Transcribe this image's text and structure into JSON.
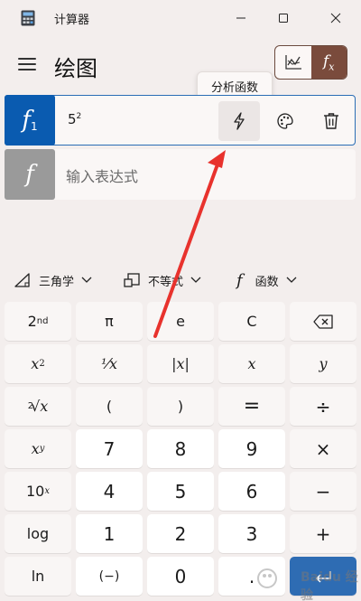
{
  "window": {
    "app_title": "计算器"
  },
  "header": {
    "page_title": "绘图"
  },
  "tooltip": {
    "text": "分析函数"
  },
  "functions": [
    {
      "badge": "f",
      "index": "1",
      "base": "5",
      "exponent": "2"
    },
    {
      "badge": "f",
      "placeholder": "输入表达式"
    }
  ],
  "toolbar": {
    "trig_label": "三角学",
    "inequality_label": "不等式",
    "function_label": "函数"
  },
  "keys": {
    "row1": [
      "2nd",
      "π",
      "e",
      "C",
      "backspace"
    ],
    "row2": [
      "x²",
      "⅟x",
      "|x|",
      "x",
      "y"
    ],
    "row3": [
      "²√x",
      "(",
      ")",
      "=",
      "÷"
    ],
    "row4": [
      "xʸ",
      "7",
      "8",
      "9",
      "×"
    ],
    "row5": [
      "10ˣ",
      "4",
      "5",
      "6",
      "−"
    ],
    "row6": [
      "log",
      "1",
      "2",
      "3",
      "+"
    ],
    "row7": [
      "ln",
      "(−)",
      "0",
      ".",
      "enter"
    ]
  },
  "key_text": {
    "second": "2",
    "second_sup": "nd",
    "pi": "π",
    "e": "e",
    "clear": "C",
    "x_base": "x",
    "x_sq_sup": "2",
    "reciprocal": "⅟x",
    "abs": "|x|",
    "x": "x",
    "y": "y",
    "root_idx": "2",
    "root": "√x",
    "lparen": "(",
    "rparen": ")",
    "equals": "=",
    "divide": "÷",
    "xy_base": "x",
    "xy_sup": "y",
    "seven": "7",
    "eight": "8",
    "nine": "9",
    "times": "×",
    "ten": "10",
    "ten_sup": "x",
    "four": "4",
    "five": "5",
    "six": "6",
    "minus": "−",
    "log": "log",
    "one": "1",
    "two": "2",
    "three": "3",
    "plus": "+",
    "ln": "ln",
    "negate": "(−)",
    "zero": "0",
    "dot": "."
  },
  "icons": {
    "app": "calculator-icon",
    "minimize": "minimize-icon",
    "maximize": "maximize-icon",
    "close": "close-icon",
    "menu": "hamburger-icon",
    "graph_mode": "graph-icon",
    "fx_mode": "fx-icon",
    "analyze": "lightning-icon",
    "style": "palette-icon",
    "delete": "trash-icon"
  },
  "colors": {
    "accent": "#0a5bb0",
    "toggle_active": "#7a4b3c",
    "annotation_arrow": "#e8322d"
  },
  "watermark": {
    "text": "Baidu 经验"
  }
}
